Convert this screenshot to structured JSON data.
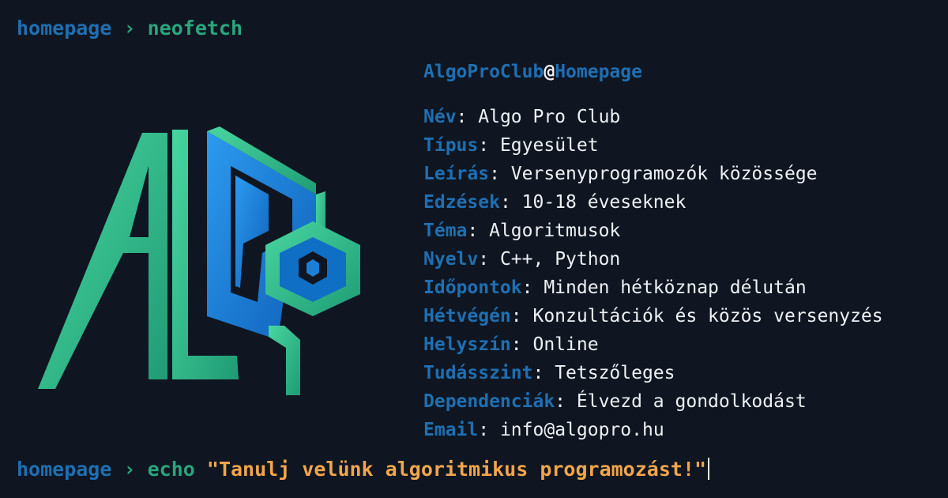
{
  "prompt1": {
    "dir": "homepage",
    "arrow": "›",
    "command": "neofetch"
  },
  "header": {
    "user": "AlgoProClub",
    "at": "@",
    "host": "Homepage"
  },
  "rows": [
    {
      "key": "Név",
      "value": "Algo Pro Club"
    },
    {
      "key": "Típus",
      "value": "Egyesület"
    },
    {
      "key": "Leírás",
      "value": "Versenyprogramozók közössége"
    },
    {
      "key": "Edzések",
      "value": "10-18 éveseknek"
    },
    {
      "key": "Téma",
      "value": "Algoritmusok"
    },
    {
      "key": "Nyelv",
      "value": "C++, Python"
    },
    {
      "key": "Időpontok",
      "value": "Minden hétköznap délután"
    },
    {
      "key": "Hétvégén",
      "value": "Konzultációk és közös versenyzés"
    },
    {
      "key": "Helyszín",
      "value": "Online"
    },
    {
      "key": "Tudásszint",
      "value": "Tetszőleges"
    },
    {
      "key": "Dependenciák",
      "value": "Élvezd a gondolkodást"
    },
    {
      "key": "Email",
      "value": "info@algopro.hu"
    }
  ],
  "separator": ": ",
  "prompt2": {
    "dir": "homepage",
    "arrow": "›",
    "command": "echo",
    "argument": "\"Tanulj velünk algoritmikus programozást!\""
  },
  "colors": {
    "background": "#0f1621",
    "key": "#1f6fb2",
    "green": "#2aa57c",
    "string": "#f2a54b",
    "text": "#eef1f4"
  },
  "logo": {
    "icon": "algo-pro-club-logo-icon"
  }
}
